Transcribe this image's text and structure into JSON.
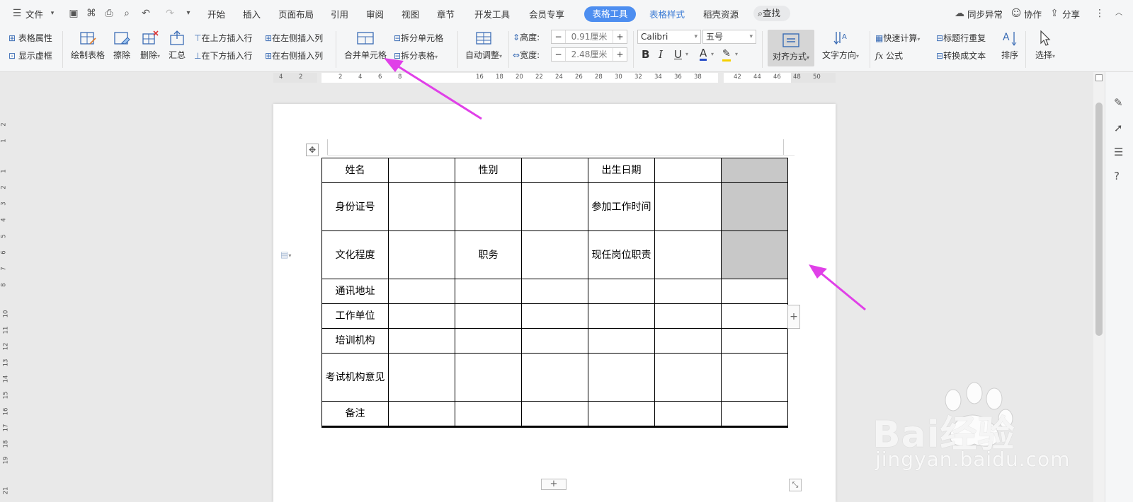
{
  "menubar": {
    "file_label": "文件",
    "tabs": [
      "开始",
      "插入",
      "页面布局",
      "引用",
      "审阅",
      "视图",
      "章节",
      "开发工具",
      "会员专享"
    ],
    "active_tab": "表格工具",
    "extra_tabs": [
      "表格样式",
      "稻壳资源"
    ],
    "search_label": "查找",
    "sync_label": "同步异常",
    "collab_label": "协作",
    "share_label": "分享"
  },
  "ribbon": {
    "table_props": "表格属性",
    "show_gridlines": "显示虚框",
    "draw_table": "绘制表格",
    "erase": "擦除",
    "delete": "删除",
    "summary": "汇总",
    "insert_above": "在上方插入行",
    "insert_below": "在下方插入行",
    "insert_left": "在左侧插入列",
    "insert_right": "在右侧插入列",
    "merge_cells": "合并单元格",
    "split_cells": "拆分单元格",
    "split_table": "拆分表格",
    "auto_fit": "自动调整",
    "height_label": "高度:",
    "height_value": "0.91厘米",
    "width_label": "宽度:",
    "width_value": "2.48厘米",
    "font_name": "Calibri",
    "font_size": "五号",
    "bold": "B",
    "italic": "I",
    "underline": "U",
    "font_color": "A",
    "align": "对齐方式",
    "text_direction": "文字方向",
    "quick_calc": "快速计算",
    "formula": "公式",
    "repeat_header": "标题行重复",
    "to_text": "转换成文本",
    "sort": "排序",
    "select": "选择"
  },
  "hruler_ticks": [
    "4",
    "2",
    "2",
    "4",
    "6",
    "8",
    "16",
    "18",
    "20",
    "22",
    "24",
    "26",
    "28",
    "30",
    "32",
    "34",
    "36",
    "38",
    "42",
    "44",
    "46",
    "48",
    "50"
  ],
  "vruler_ticks": [
    "2",
    "1",
    "1",
    "2",
    "3",
    "4",
    "5",
    "6",
    "7",
    "8",
    "10",
    "11",
    "12",
    "13",
    "14",
    "15",
    "16",
    "17",
    "18",
    "19",
    "21"
  ],
  "table": {
    "rows": [
      [
        "姓名",
        "",
        "性别",
        "",
        "出生日期",
        "",
        ""
      ],
      [
        "身份证号",
        "",
        "",
        "",
        "参加工作时间",
        "",
        ""
      ],
      [
        "文化程度",
        "",
        "职务",
        "",
        "现任岗位职责",
        "",
        ""
      ],
      [
        "通讯地址",
        "",
        "",
        "",
        "",
        "",
        ""
      ],
      [
        "工作单位",
        "",
        "",
        "",
        "",
        "",
        ""
      ],
      [
        "培训机构",
        "",
        "",
        "",
        "",
        "",
        ""
      ],
      [
        "考试机构意见",
        "",
        "",
        "",
        "",
        "",
        ""
      ],
      [
        "备注",
        "",
        "",
        "",
        "",
        "",
        ""
      ],
      [
        "",
        "",
        "",
        "",
        "",
        "",
        ""
      ],
      [
        "",
        "",
        "",
        "",
        "",
        "",
        ""
      ]
    ],
    "add_row": "+",
    "add_col": "+"
  },
  "watermark": {
    "brand": "Bai经验",
    "url": "jingyan.baidu.com"
  },
  "colors": {
    "accent": "#4d8ef0",
    "arrow": "#e040e8",
    "shaded_cell": "#c8c8c8"
  }
}
